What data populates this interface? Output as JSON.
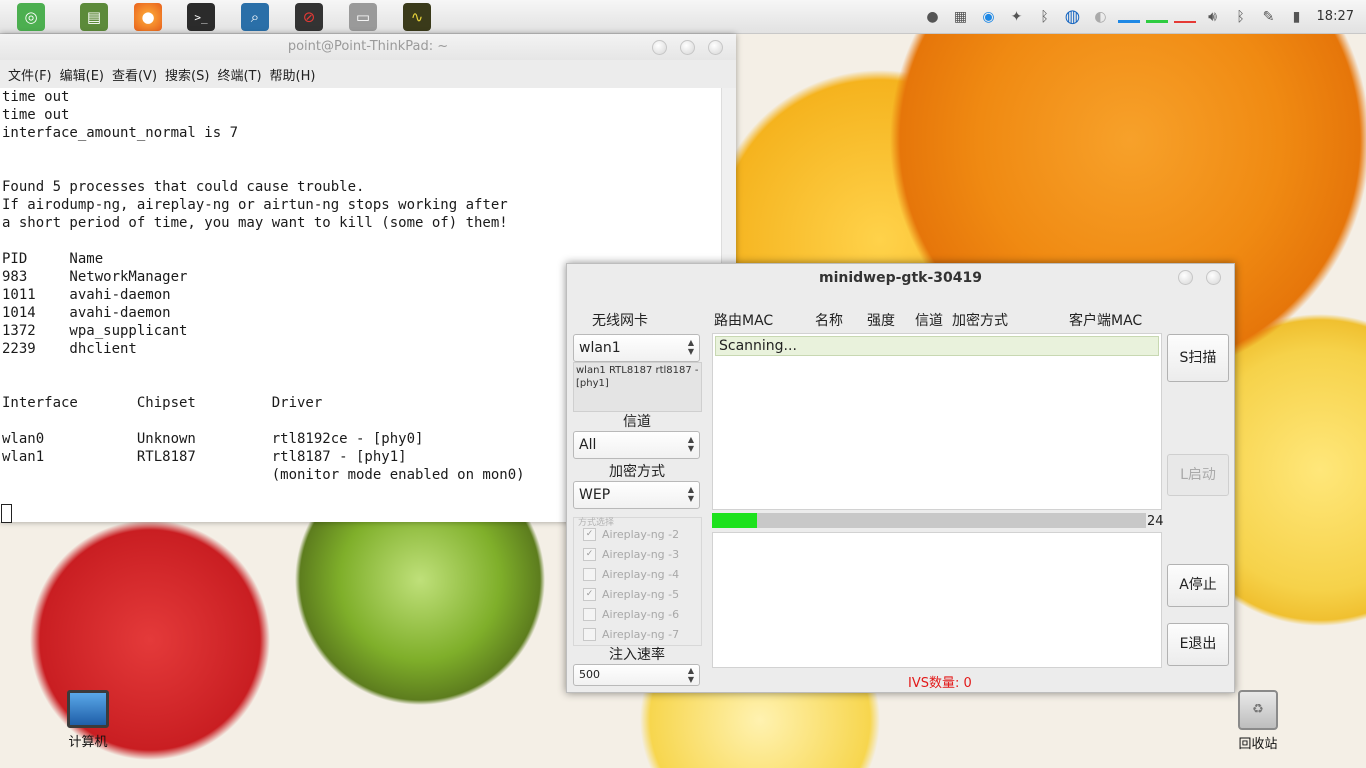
{
  "top_panel": {
    "launchers": [
      {
        "name": "deepin-logo-icon",
        "color": "#4caf50"
      },
      {
        "name": "system-monitor-icon",
        "color": "#5c8a3a"
      },
      {
        "name": "firefox-icon",
        "color": "#e8601c"
      },
      {
        "name": "terminal-icon",
        "color": "#2b2b2b"
      },
      {
        "name": "search-icon",
        "color": "#2a6fa8"
      },
      {
        "name": "stop-app-icon",
        "color": "#b71c1c"
      },
      {
        "name": "disk-icon",
        "color": "#8a8a8a"
      },
      {
        "name": "activity-monitor-icon",
        "color": "#3a3a1a"
      }
    ],
    "clock": "18:27"
  },
  "terminal": {
    "title": "point@Point-ThinkPad: ~",
    "menu": [
      "文件(F)",
      "编辑(E)",
      "查看(V)",
      "搜索(S)",
      "终端(T)",
      "帮助(H)"
    ],
    "lines": [
      "time out",
      "time out",
      "interface_amount_normal is 7",
      "",
      "",
      "Found 5 processes that could cause trouble.",
      "If airodump-ng, aireplay-ng or airtun-ng stops working after",
      "a short period of time, you may want to kill (some of) them!",
      "",
      "PID     Name",
      "983     NetworkManager",
      "1011    avahi-daemon",
      "1014    avahi-daemon",
      "1372    wpa_supplicant",
      "2239    dhclient",
      "",
      "",
      "Interface       Chipset         Driver",
      "",
      "wlan0           Unknown         rtl8192ce - [phy0]",
      "wlan1           RTL8187         rtl8187 - [phy1]",
      "                                (monitor mode enabled on mon0)"
    ]
  },
  "minidwep": {
    "title": "minidwep-gtk-30419",
    "col_card": "无线网卡",
    "col_mac": "路由MAC",
    "col_name": "名称",
    "col_signal": "强度",
    "col_channel": "信道",
    "col_enc": "加密方式",
    "col_client": "客户端MAC",
    "card_value": "wlan1",
    "card_info": "wlan1 RTL8187 rtl8187 - [phy1]",
    "channel_label": "信道",
    "channel_value": "All",
    "enc_label": "加密方式",
    "enc_value": "WEP",
    "method_legend": "方式选择",
    "methods": [
      {
        "label": "Aireplay-ng -2",
        "checked": true
      },
      {
        "label": "Aireplay-ng -3",
        "checked": true
      },
      {
        "label": "Aireplay-ng -4",
        "checked": false
      },
      {
        "label": "Aireplay-ng -5",
        "checked": true
      },
      {
        "label": "Aireplay-ng -6",
        "checked": false
      },
      {
        "label": "Aireplay-ng -7",
        "checked": false
      }
    ],
    "rate_label": "注入速率",
    "rate_value": "500",
    "scan_status": "Scanning...",
    "progress_count": "24",
    "ivs_label": "IVS数量: 0",
    "buttons": {
      "scan": "S扫描",
      "start": "L启动",
      "stop": "A停止",
      "exit": "E退出"
    }
  },
  "desktop": {
    "computer_label": "计算机",
    "trash_label": "回收站"
  }
}
